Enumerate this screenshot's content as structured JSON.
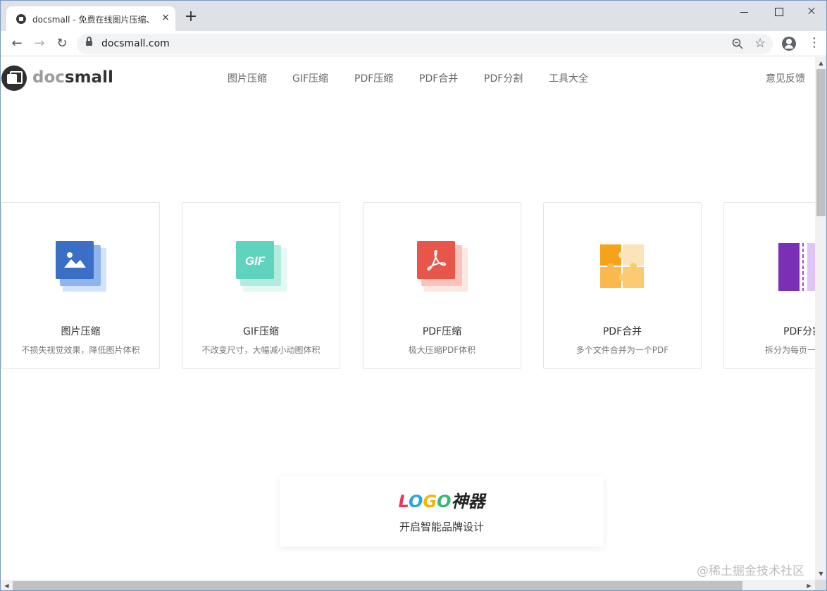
{
  "browser": {
    "tab_title": "docsmall - 免费在线图片压缩、G",
    "url": "docsmall.com",
    "new_tab_label": "+",
    "close_label": "×",
    "back_label": "←",
    "forward_label": "→",
    "reload_label": "↻"
  },
  "site": {
    "logo_doc": "doc",
    "logo_small": "small",
    "nav": [
      {
        "label": "图片压缩"
      },
      {
        "label": "GIF压缩"
      },
      {
        "label": "PDF压缩"
      },
      {
        "label": "PDF合并"
      },
      {
        "label": "PDF分割"
      },
      {
        "label": "工具大全"
      }
    ],
    "feedback": "意见反馈"
  },
  "cards": [
    {
      "title": "图片压缩",
      "desc": "不损失视觉效果，降低图片体积",
      "color": "#3b6fc6",
      "back_color": "#c9dcf8",
      "icon": "image-icon"
    },
    {
      "title": "GIF压缩",
      "desc": "不改变尺寸，大幅减小动图体积",
      "color": "#5fd3bd",
      "back_color": "#d3f5ec",
      "icon": "gif-icon",
      "icon_text": "GIF"
    },
    {
      "title": "PDF压缩",
      "desc": "极大压缩PDF体积",
      "color": "#e8554a",
      "back_color": "#fbd6cf",
      "icon": "pdf-icon"
    },
    {
      "title": "PDF合并",
      "desc": "多个文件合并为一个PDF",
      "color": "#f7a21b",
      "back_color": "#fde3b8",
      "icon": "puzzle-icon"
    },
    {
      "title": "PDF分割",
      "desc": "拆分为每页一",
      "color": "#7b2fb4",
      "back_color": "#e0c4f5",
      "icon": "split-icon"
    }
  ],
  "ad": {
    "logo_l": "L",
    "logo_o1": "O",
    "logo_g": "G",
    "logo_o2": "O",
    "logo_cn": "神器",
    "subtitle": "开启智能品牌设计"
  },
  "watermark": "@稀土掘金技术社区"
}
